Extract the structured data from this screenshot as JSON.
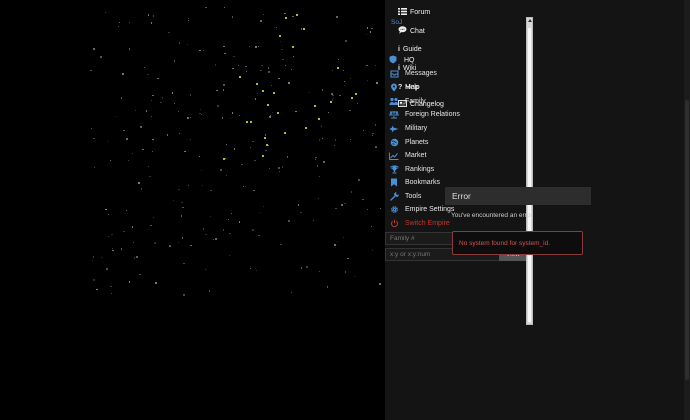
{
  "nav": {
    "items": [
      {
        "label": "Messages",
        "icon": "inbox-icon"
      },
      {
        "label": "Map",
        "icon": "map-pin-icon"
      },
      {
        "label": "Family",
        "icon": "family-icon"
      },
      {
        "label": "Foreign Relations",
        "icon": "scales-icon"
      },
      {
        "label": "Military",
        "icon": "jet-icon"
      },
      {
        "label": "Planets",
        "icon": "globe-icon"
      },
      {
        "label": "Market",
        "icon": "chart-line-icon"
      },
      {
        "label": "Rankings",
        "icon": "trophy-icon"
      },
      {
        "label": "Bookmarks",
        "icon": "bookmark-icon"
      },
      {
        "label": "Tools",
        "icon": "wrench-icon"
      },
      {
        "label": "Empire Settings",
        "icon": "gear-icon"
      },
      {
        "label": "Switch Empire",
        "icon": "power-icon"
      }
    ]
  },
  "overlay": {
    "forum": "Forum",
    "soj": "SoJ",
    "chat": "Chat",
    "guide": "Guide",
    "hq": "HQ",
    "wiki": "Wiki",
    "help": "Help",
    "changelog": "Changelog"
  },
  "search": {
    "family_placeholder": "Family #",
    "coord_placeholder": "x:y or x:y:num",
    "view_label": "View"
  },
  "error": {
    "title": "Error",
    "message": "You've encountered an error",
    "alert": "No system found for system_id."
  },
  "colors": {
    "accent": "#4a8fd4",
    "danger": "#c0392b",
    "star_bright": "#f4f442"
  }
}
